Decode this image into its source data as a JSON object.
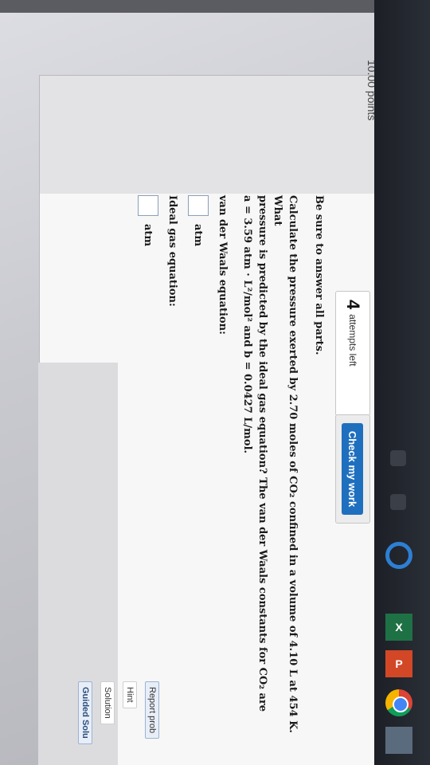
{
  "header": {
    "points_text": "10.00 points"
  },
  "attempts": {
    "count": "4",
    "label": "attempts left"
  },
  "check_button": {
    "label": "Check my work"
  },
  "problem": {
    "intro": "Be sure to answer all parts.",
    "question_line1": "Calculate the pressure exerted by 2.70 moles of CO₂ confined in a volume of 4.10 L at 454 K. What",
    "question_line2": "pressure is predicted by the ideal gas equation? The van der Waals constants for CO₂ are",
    "question_line3": "a = 3.59 atm · L²/mol² and b = 0.0427 L/mol.",
    "vdw_label": "van der Waals equation:",
    "vdw_unit": "atm",
    "ideal_label": "Ideal gas equation:",
    "ideal_unit": "atm"
  },
  "tools": {
    "report": "Report prob",
    "hint": "Hint",
    "solution": "Solution",
    "guided": "Guided Solu"
  },
  "taskbar": {
    "excel": "X",
    "ppt": "P"
  }
}
